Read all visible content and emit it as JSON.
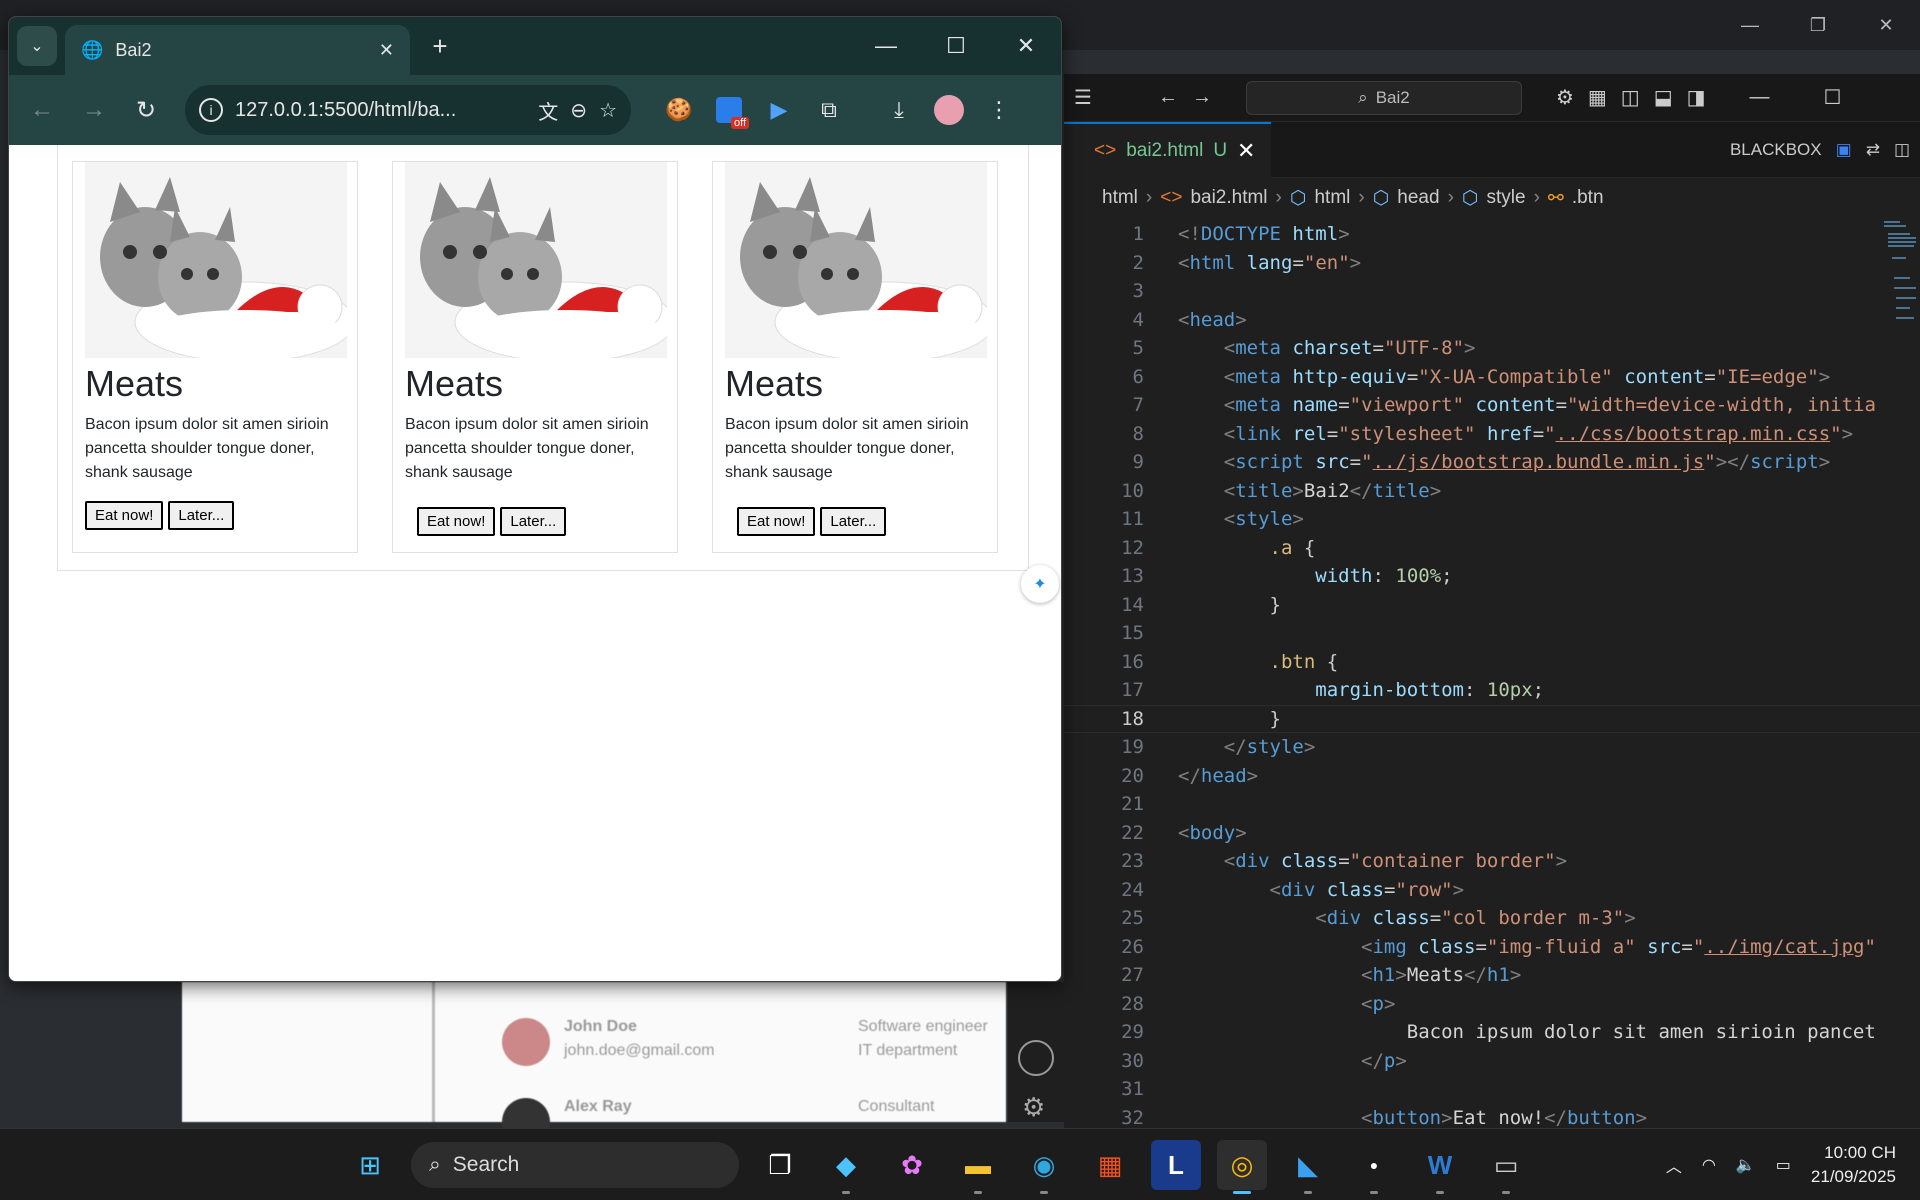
{
  "chrome": {
    "tab_title": "Bai2",
    "url": "127.0.0.1:5500/html/ba...",
    "extension_badge": "off"
  },
  "webpage": {
    "cards": [
      {
        "title": "Meats",
        "text": "Bacon ipsum dolor sit amen sirioin pancetta shoulder tongue doner, shank sausage",
        "primary_button": "Eat now!",
        "secondary_button": "Later..."
      },
      {
        "title": "Meats",
        "text": "Bacon ipsum dolor sit amen sirioin pancetta shoulder tongue doner, shank sausage",
        "primary_button": "Eat now!",
        "secondary_button": "Later..."
      },
      {
        "title": "Meats",
        "text": "Bacon ipsum dolor sit amen sirioin pancetta shoulder tongue doner, shank sausage",
        "primary_button": "Eat now!",
        "secondary_button": "Later..."
      }
    ]
  },
  "vscode": {
    "search_text": "Bai2",
    "tab_name": "bai2.html",
    "tab_status": "U",
    "blackbox_label": "BLACKBOX",
    "breadcrumb": [
      "html",
      "bai2.html",
      "html",
      "head",
      "style",
      ".btn"
    ],
    "current_line": 18
  },
  "background_app": {
    "name": "John Doe",
    "email": "john.doe@gmail.com",
    "role": "Software engineer",
    "dept": "IT department",
    "name2": "Alex Ray",
    "role2": "Consultant"
  },
  "taskbar": {
    "search_label": "Search",
    "time": "10:00 CH",
    "date": "21/09/2025"
  }
}
